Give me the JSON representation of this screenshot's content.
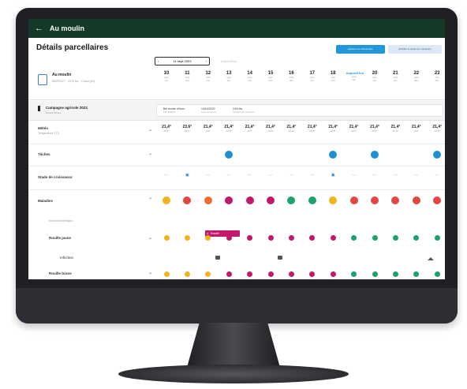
{
  "app": {
    "back_label": "←",
    "title": "Au moulin"
  },
  "page": {
    "title": "Détails parcellaires"
  },
  "header_buttons": [
    "Ajouter une intervention",
    "Modifier le stade de croissance"
  ],
  "date_picker": {
    "prev": "‹",
    "label": "11 sept 2023",
    "next": "›",
    "today_link": "Aujourd'hui"
  },
  "farm": {
    "name": "Au moulin",
    "sub": "BERSOT · 12,5 ha · Colza (bl)"
  },
  "days": [
    {
      "n": "10",
      "l1": "sept",
      "l2": "lun"
    },
    {
      "n": "11",
      "l1": "sept",
      "l2": "mar"
    },
    {
      "n": "12",
      "l1": "sept",
      "l2": "mer"
    },
    {
      "n": "13",
      "l1": "sept",
      "l2": "jeu"
    },
    {
      "n": "14",
      "l1": "sept",
      "l2": "ven"
    },
    {
      "n": "15",
      "l1": "sept",
      "l2": "sam"
    },
    {
      "n": "16",
      "l1": "sept",
      "l2": "dim"
    },
    {
      "n": "17",
      "l1": "sept",
      "l2": "lun"
    },
    {
      "n": "18",
      "l1": "sept",
      "l2": "mar"
    },
    {
      "n": "Aujourd'hui",
      "l1": "sept",
      "l2": "mer",
      "today": true
    },
    {
      "n": "20",
      "l1": "sept",
      "l2": "jeu"
    },
    {
      "n": "21",
      "l1": "sept",
      "l2": "ven"
    },
    {
      "n": "22",
      "l1": "sept",
      "l2": "sam"
    },
    {
      "n": "23",
      "l1": "sept",
      "l2": "dim"
    }
  ],
  "campaign": {
    "label": "Campagne agricole 2023",
    "sub": "Détails actuels",
    "info": [
      {
        "a": "Blé tendre d'hiver",
        "b": "14/10/2022"
      },
      {
        "a": "14/10/2022",
        "b": "Date de semis"
      },
      {
        "a": "3,54 Ha",
        "b": "Surface de semence"
      }
    ]
  },
  "rows": {
    "meteo": {
      "label": "Météo",
      "sub": "Température (°C)"
    },
    "taches": {
      "label": "Tâches"
    },
    "stade": {
      "label": "Stade de croissance"
    },
    "maladies": {
      "label": "Maladies"
    },
    "environ": {
      "label": "Environnementales"
    },
    "rouille_jaune": {
      "label": "Rouille jaune"
    },
    "infection": {
      "label": "Infection"
    },
    "rouille_brune": {
      "label": "Rouille brune"
    }
  },
  "temps": [
    {
      "t": "21,4°",
      "s": "16,8°"
    },
    {
      "t": "23,6°",
      "s": "15,9°"
    },
    {
      "t": "21,4°",
      "s": "16,8°"
    },
    {
      "t": "21,4°",
      "s": "16,8°"
    },
    {
      "t": "21,4°",
      "s": "16,8°"
    },
    {
      "t": "21,4°",
      "s": "16,8°"
    },
    {
      "t": "21,4°",
      "s": "16,8°"
    },
    {
      "t": "21,4°",
      "s": "16,8°"
    },
    {
      "t": "21,4°",
      "s": "16,8°"
    },
    {
      "t": "21,4°",
      "s": "16,8°"
    },
    {
      "t": "21,4°",
      "s": "16,8°"
    },
    {
      "t": "21,4°",
      "s": "16,8°"
    },
    {
      "t": "21,4°",
      "s": "16,8°"
    },
    {
      "t": "21,4°",
      "s": "16,8°"
    }
  ],
  "tasks": [
    null,
    null,
    null,
    "#1f8fd6",
    null,
    null,
    null,
    null,
    "#1f8fd6",
    null,
    "#1f8fd6",
    null,
    null,
    "#1f8fd6"
  ],
  "stade": [
    "—",
    "▣",
    "—",
    "—",
    "—",
    "—",
    "—",
    "—",
    "▣",
    "—",
    "—",
    "—",
    "—",
    "—"
  ],
  "disease_colors": [
    "#f2b31b",
    "#e4463f",
    "#f06a2d",
    "#c2186b",
    "#c2186b",
    "#c2186b",
    "#1ca26b",
    "#1ca26b",
    "#f2b31b",
    "#e4463f",
    "#e4463f",
    "#e4463f",
    "#e4463f",
    "#e4463f"
  ],
  "disease_tag": "4 · Rouille",
  "rj_colors": [
    "#f2b31b",
    "#f2b31b",
    "#f2b31b",
    "#c2186b",
    "#c2186b",
    "#c2186b",
    "#c2186b",
    "#c2186b",
    "#c2186b",
    "#1ca26b",
    "#1ca26b",
    "#1ca26b",
    "#1ca26b",
    "#1ca26b"
  ],
  "rb_colors": [
    "#f2b31b",
    "#f2b31b",
    "#f2b31b",
    "#c2186b",
    "#c2186b",
    "#c2186b",
    "#c2186b",
    "#c2186b",
    "#c2186b",
    "#1ca26b",
    "#1ca26b",
    "#1ca26b",
    "#1ca26b",
    "#1ca26b"
  ],
  "chevrons": {
    "down": "⌄",
    "up": "⌃"
  }
}
